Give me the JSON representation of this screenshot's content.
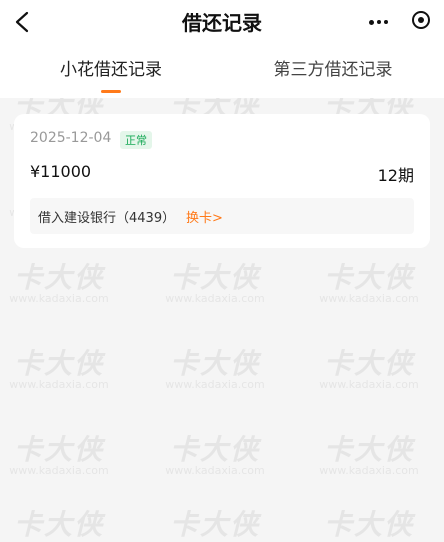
{
  "nav": {
    "title": "借还记录",
    "back_icon": "chevron-left-icon",
    "more_icon": "more-dots-icon",
    "target_icon": "target-icon"
  },
  "tabs": [
    {
      "label": "小花借还记录",
      "active": true
    },
    {
      "label": "第三方借还记录",
      "active": false
    }
  ],
  "record": {
    "date": "2025-12-04",
    "status": "正常",
    "amount": "¥11000",
    "periods": "12期",
    "bank_text": "借入建设银行（4439）",
    "change_card": "换卡>"
  },
  "watermark": {
    "brand": "卡大侠",
    "url": "www.kadaxia.com"
  },
  "colors": {
    "accent": "#ff7a1a",
    "status_green": "#18a957"
  }
}
